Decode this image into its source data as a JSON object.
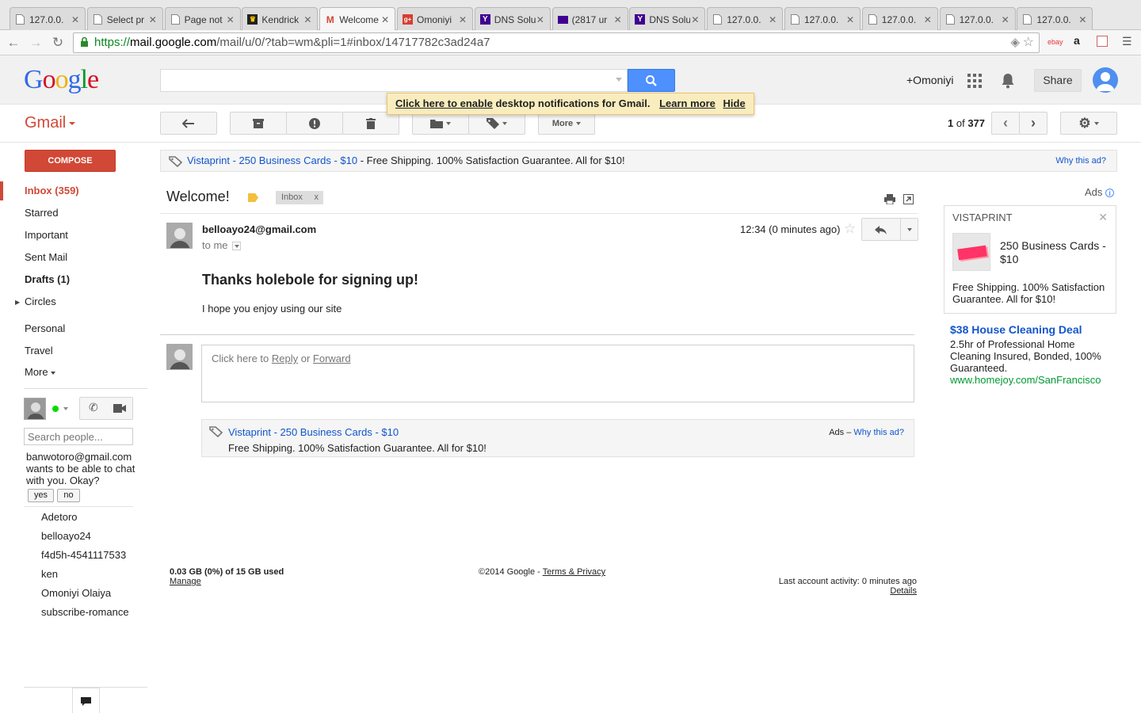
{
  "browser": {
    "tabs": [
      {
        "title": "127.0.0.",
        "icon": "page"
      },
      {
        "title": "Select pr",
        "icon": "page"
      },
      {
        "title": "Page not",
        "icon": "page"
      },
      {
        "title": "Kendrick",
        "icon": "kendrick"
      },
      {
        "title": "Welcome",
        "icon": "gmail",
        "active": true
      },
      {
        "title": "Omoniyi",
        "icon": "gplus"
      },
      {
        "title": "DNS Solu",
        "icon": "yahoo"
      },
      {
        "title": "(2817 ur",
        "icon": "yahoo-mail"
      },
      {
        "title": "DNS Solu",
        "icon": "yahoo"
      },
      {
        "title": "127.0.0.",
        "icon": "page"
      },
      {
        "title": "127.0.0.",
        "icon": "page"
      },
      {
        "title": "127.0.0.",
        "icon": "page"
      },
      {
        "title": "127.0.0.",
        "icon": "page"
      },
      {
        "title": "127.0.0.",
        "icon": "page"
      }
    ],
    "url_protocol": "https://",
    "url_host": "mail.google.com",
    "url_path": "/mail/u/0/?tab=wm&pli=1#inbox/14717782c3ad24a7",
    "extensions": [
      "ebay",
      "a"
    ]
  },
  "header": {
    "logo": "Google",
    "user": "+Omoniyi",
    "share_label": "Share"
  },
  "notification": {
    "enable_link": "Click here to enable",
    "text": " desktop notifications for Gmail.",
    "learn_more": "Learn more",
    "hide": "Hide"
  },
  "toolbar": {
    "gmail_label": "Gmail",
    "more_label": "More",
    "pager_current": "1",
    "pager_of": " of ",
    "pager_total": "377"
  },
  "nav": {
    "compose": "COMPOSE",
    "items": [
      {
        "label": "Inbox (359)"
      },
      {
        "label": "Starred"
      },
      {
        "label": "Important"
      },
      {
        "label": "Sent Mail"
      },
      {
        "label": "Drafts (1)"
      },
      {
        "label": "Circles"
      },
      {
        "label": "Personal"
      },
      {
        "label": "Travel"
      },
      {
        "label": "More"
      }
    ]
  },
  "chat": {
    "search_placeholder": "Search people...",
    "invite_text": "banwotoro@gmail.com wants to be able to chat with you. Okay?",
    "yes": "yes",
    "no": "no",
    "contacts": [
      "Adetoro",
      "belloayo24",
      "f4d5h-4541117533",
      "ken",
      "Omoniyi Olaiya",
      "subscribe-romance"
    ],
    "status_color": "#0d0"
  },
  "top_ad": {
    "link": "Vistaprint - 250 Business Cards - $10",
    "text": " - Free Shipping. 100% Satisfaction Guarantee. All for $10!",
    "why": "Why this ad?"
  },
  "message": {
    "subject": "Welcome!",
    "label_chip": "Inbox",
    "label_chip_close": "x",
    "sender": "belloayo24@gmail.com",
    "to": "to me",
    "time": "12:34 (0 minutes ago)",
    "title": "Thanks holebole for signing up!",
    "body": "I hope you enjoy using our site"
  },
  "reply": {
    "prefix": "Click here to ",
    "reply": "Reply",
    "or": " or ",
    "forward": "Forward"
  },
  "bottom_ad": {
    "link": "Vistaprint - 250 Business Cards - $10",
    "text": "Free Shipping. 100% Satisfaction Guarantee. All for $10!",
    "ads": "Ads",
    "dash": " – ",
    "why": "Why this ad?"
  },
  "footer": {
    "storage": "0.03 GB (0%) of 15 GB used",
    "manage": "Manage",
    "copyright": "©2014 Google - ",
    "terms": "Terms & Privacy",
    "activity": "Last account activity: 0 minutes ago",
    "details": "Details"
  },
  "right_ads": {
    "header": "Ads",
    "ad1_brand": "VISTAPRINT",
    "ad1_title": "250 Business Cards - $10",
    "ad1_body": "Free Shipping. 100% Satisfaction Guarantee. All for $10!",
    "ad2_title": "$38 House Cleaning Deal",
    "ad2_body": "2.5hr of Professional Home Cleaning Insured, Bonded, 100% Guaranteed.",
    "ad2_url": "www.homejoy.com/SanFrancisco"
  },
  "colors": {
    "gmail_red": "#d14836",
    "link_blue": "#1155cc",
    "search_blue": "#4d90fe",
    "notif_yellow": "#f9edbe"
  }
}
